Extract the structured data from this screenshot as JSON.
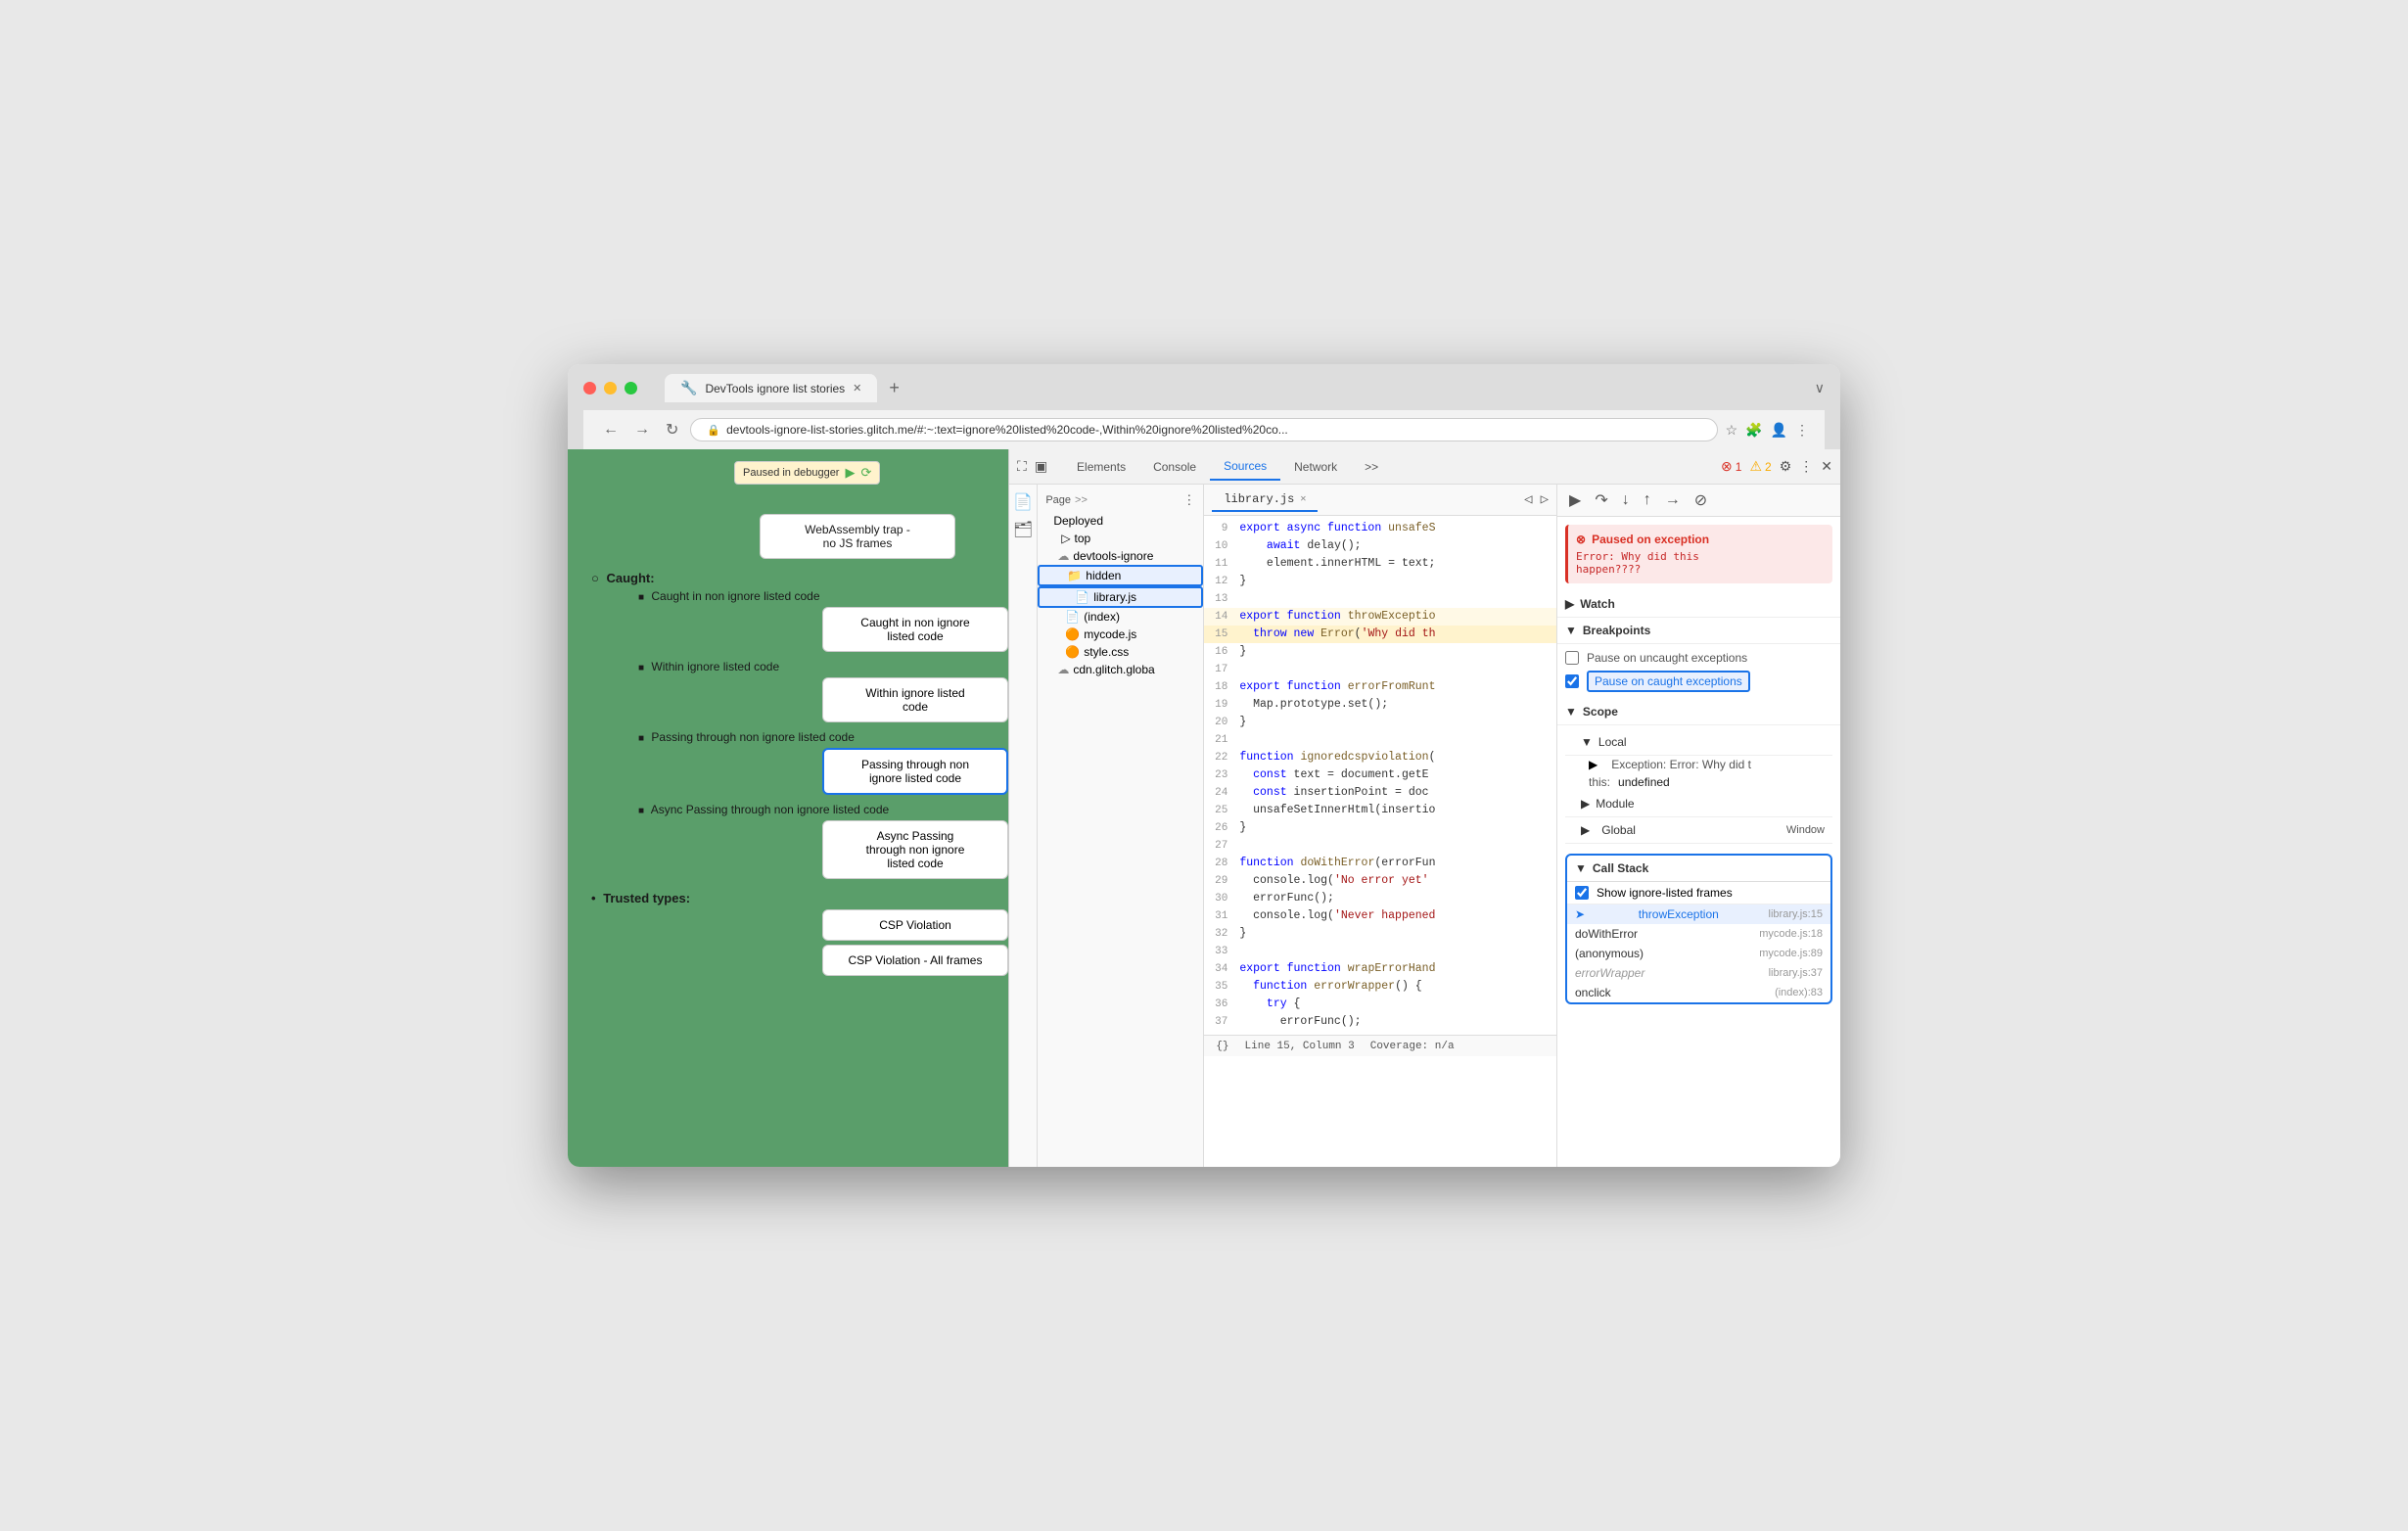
{
  "browser": {
    "tab_title": "DevTools ignore list stories",
    "address": "devtools-ignore-list-stories.glitch.me/#:~:text=ignore%20listed%20code-,Within%20ignore%20listed%20co...",
    "nav_back": "←",
    "nav_forward": "→",
    "nav_reload": "↻"
  },
  "page": {
    "paused_badge": "Paused in debugger",
    "webassembly_label": "WebAssembly trap -\nno JS frames",
    "caught_label": "Caught:",
    "caught_non_ignore": "Caught in non ignore listed code",
    "caught_btn": "Caught in non ignore\nlisted code",
    "within_ignore_label": "Within ignore listed code",
    "within_btn": "Within ignore listed\ncode",
    "passing_label": "Passing through non ignore listed code",
    "passing_btn": "Passing through non\nignore listed code",
    "async_label": "Async Passing through non ignore listed code",
    "async_btn": "Async Passing\nthrough non ignore\nlisted code",
    "trusted_label": "Trusted types:",
    "csp_btn": "CSP Violation",
    "csp_all_btn": "CSP Violation - All frames"
  },
  "devtools": {
    "tabs": [
      "Elements",
      "Console",
      "Sources",
      "Network"
    ],
    "active_tab": "Sources",
    "settings_icon": "⚙",
    "close_icon": "✕",
    "more_icon": "⋮",
    "error_count": "1",
    "warning_count": "2"
  },
  "sources": {
    "page_label": "Page",
    "deployed_label": "Deployed",
    "top_label": "top",
    "devtools_ignore_label": "devtools-ignore",
    "hidden_folder": "hidden",
    "library_js": "library.js",
    "index_file": "(index)",
    "mycode_js": "mycode.js",
    "style_css": "style.css",
    "cdn_glitch": "cdn.glitch.globa",
    "active_file": "library.js",
    "statusbar_line": "Line 15, Column 3",
    "statusbar_coverage": "Coverage: n/a"
  },
  "code": {
    "lines": [
      {
        "num": 9,
        "text": "  export async function unsafeS",
        "active": false
      },
      {
        "num": 10,
        "text": "    await delay();",
        "active": false
      },
      {
        "num": 11,
        "text": "    element.innerHTML = text;",
        "active": false
      },
      {
        "num": 12,
        "text": "}",
        "active": false
      },
      {
        "num": 13,
        "text": "",
        "active": false
      },
      {
        "num": 14,
        "text": "export function throwExceptio",
        "active": false,
        "highlight": true
      },
      {
        "num": 15,
        "text": "  throw new Error('Why did th",
        "active": true
      },
      {
        "num": 16,
        "text": "}",
        "active": false
      },
      {
        "num": 17,
        "text": "",
        "active": false
      },
      {
        "num": 18,
        "text": "export function errorFromRunt",
        "active": false
      },
      {
        "num": 19,
        "text": "  Map.prototype.set();",
        "active": false
      },
      {
        "num": 20,
        "text": "}",
        "active": false
      },
      {
        "num": 21,
        "text": "",
        "active": false
      },
      {
        "num": 22,
        "text": "function ignoredcspviolation(",
        "active": false
      },
      {
        "num": 23,
        "text": "  const text = document.getE",
        "active": false
      },
      {
        "num": 24,
        "text": "  const insertionPoint = doc",
        "active": false
      },
      {
        "num": 25,
        "text": "  unsafeSetInnerHtml(insertio",
        "active": false
      },
      {
        "num": 26,
        "text": "}",
        "active": false
      },
      {
        "num": 27,
        "text": "",
        "active": false
      },
      {
        "num": 28,
        "text": "function doWithError(errorFun",
        "active": false
      },
      {
        "num": 29,
        "text": "  console.log('No error yet'",
        "active": false
      },
      {
        "num": 30,
        "text": "  errorFunc();",
        "active": false
      },
      {
        "num": 31,
        "text": "  console.log('Never happened",
        "active": false
      },
      {
        "num": 32,
        "text": "}",
        "active": false
      },
      {
        "num": 33,
        "text": "",
        "active": false
      },
      {
        "num": 34,
        "text": "export function wrapErrorHand",
        "active": false
      },
      {
        "num": 35,
        "text": "  function errorWrapper() {",
        "active": false
      },
      {
        "num": 36,
        "text": "    try {",
        "active": false
      },
      {
        "num": 37,
        "text": "      errorFunc();",
        "active": false
      }
    ]
  },
  "inspector": {
    "exception_title": "Paused on exception",
    "exception_msg": "Error: Why did this\nhappen????",
    "watch_label": "Watch",
    "breakpoints_label": "Breakpoints",
    "pause_uncaught": "Pause on uncaught exceptions",
    "pause_caught": "Pause on caught exceptions",
    "pause_caught_checked": true,
    "scope_label": "Scope",
    "local_label": "Local",
    "exception_scope": "Exception: Error: Why did t",
    "this_scope": "this: undefined",
    "module_label": "Module",
    "global_label": "Global",
    "global_val": "Window",
    "call_stack_label": "Call Stack",
    "show_ignored_label": "Show ignore-listed frames",
    "call_stack_items": [
      {
        "fn": "throwException",
        "loc": "library.js:15",
        "active": true,
        "ignore_listed": false
      },
      {
        "fn": "doWithError",
        "loc": "mycode.js:18",
        "active": false,
        "ignore_listed": false
      },
      {
        "fn": "(anonymous)",
        "loc": "mycode.js:89",
        "active": false,
        "ignore_listed": false
      },
      {
        "fn": "errorWrapper",
        "loc": "library.js:37",
        "active": false,
        "ignore_listed": true
      },
      {
        "fn": "onclick",
        "loc": "(index):83",
        "active": false,
        "ignore_listed": false
      }
    ]
  }
}
